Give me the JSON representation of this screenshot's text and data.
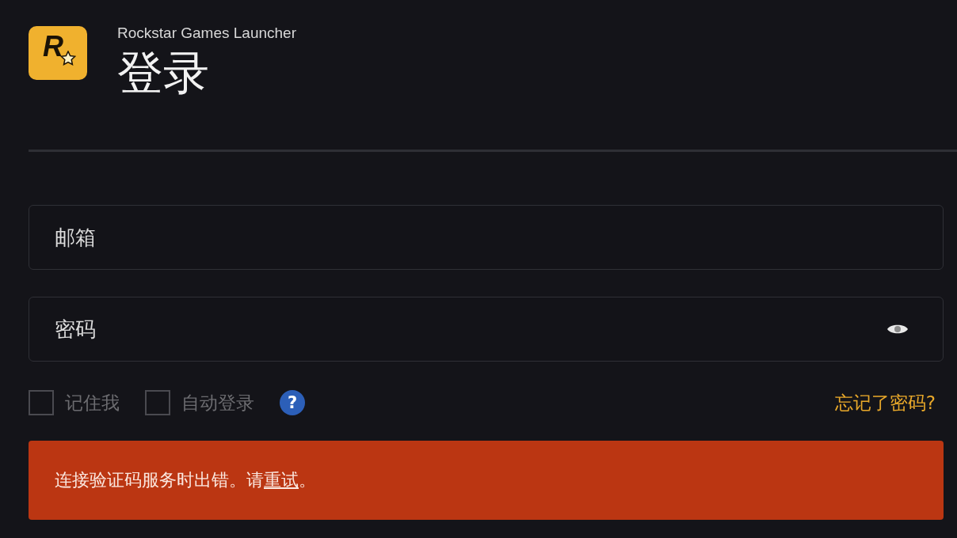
{
  "logo": {
    "letter": "R"
  },
  "header": {
    "app_name": "Rockstar Games Launcher",
    "title": "登录"
  },
  "email_field": {
    "placeholder": "邮箱"
  },
  "password_field": {
    "placeholder": "密码"
  },
  "options": [
    {
      "label": "记住我",
      "checked": false
    },
    {
      "label": "自动登录",
      "checked": false
    }
  ],
  "help": {
    "symbol": "?"
  },
  "forgot_link": "忘记了密码?",
  "error": {
    "before": "连接验证码服务时出错。请",
    "link": "重试",
    "after": "。"
  }
}
